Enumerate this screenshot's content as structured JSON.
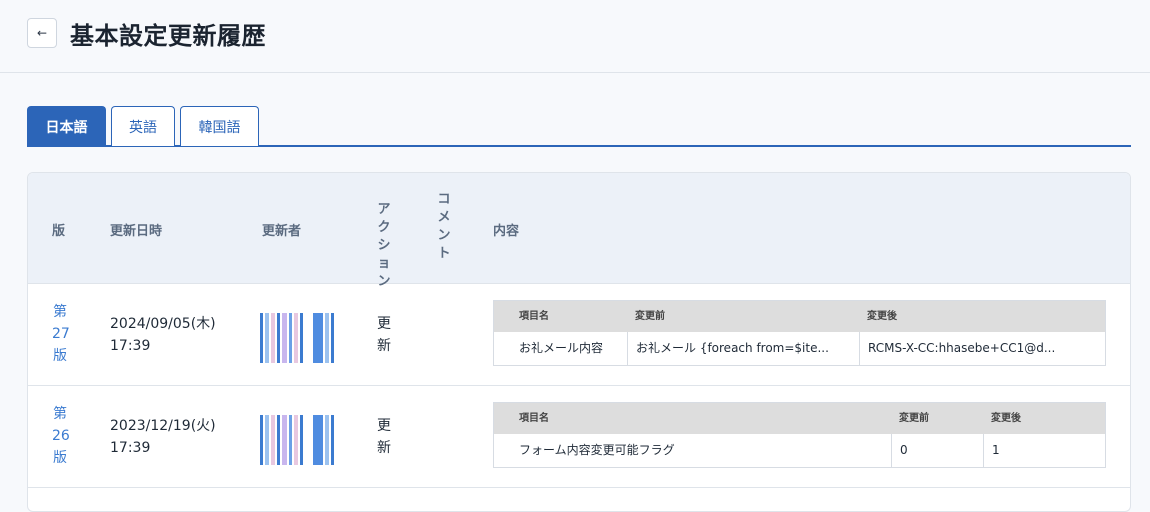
{
  "header": {
    "back_icon": "arrow-left-icon",
    "back_glyph": "←",
    "title": "基本設定更新履歴"
  },
  "tabs": [
    {
      "label": "日本語",
      "active": true
    },
    {
      "label": "英語",
      "active": false
    },
    {
      "label": "韓国語",
      "active": false
    }
  ],
  "colors": {
    "accent": "#2c65b8",
    "link": "#3b7bd0",
    "table_header_bg": "#ecf1f8"
  },
  "table": {
    "headers": {
      "version": "版",
      "datetime": "更新日時",
      "updater": "更新者",
      "action": "アクション",
      "comment": "コメント",
      "content": "内容"
    },
    "rows": [
      {
        "version": "第27版",
        "date": "2024/09/05(木)",
        "time": "17:39",
        "action": "更新",
        "diff": {
          "headers": [
            "項目名",
            "変更前",
            "変更後"
          ],
          "cells": [
            "お礼メール内容",
            "お礼メール {foreach from=$ite...",
            "RCMS-X-CC:hhasebe+CC1@d..."
          ]
        }
      },
      {
        "version": "第26版",
        "date": "2023/12/19(火)",
        "time": "17:39",
        "action": "更新",
        "diff": {
          "headers": [
            "項目名",
            "変更前",
            "変更後"
          ],
          "cells": [
            "フォーム内容変更可能フラグ",
            "0",
            "1"
          ]
        }
      }
    ]
  }
}
